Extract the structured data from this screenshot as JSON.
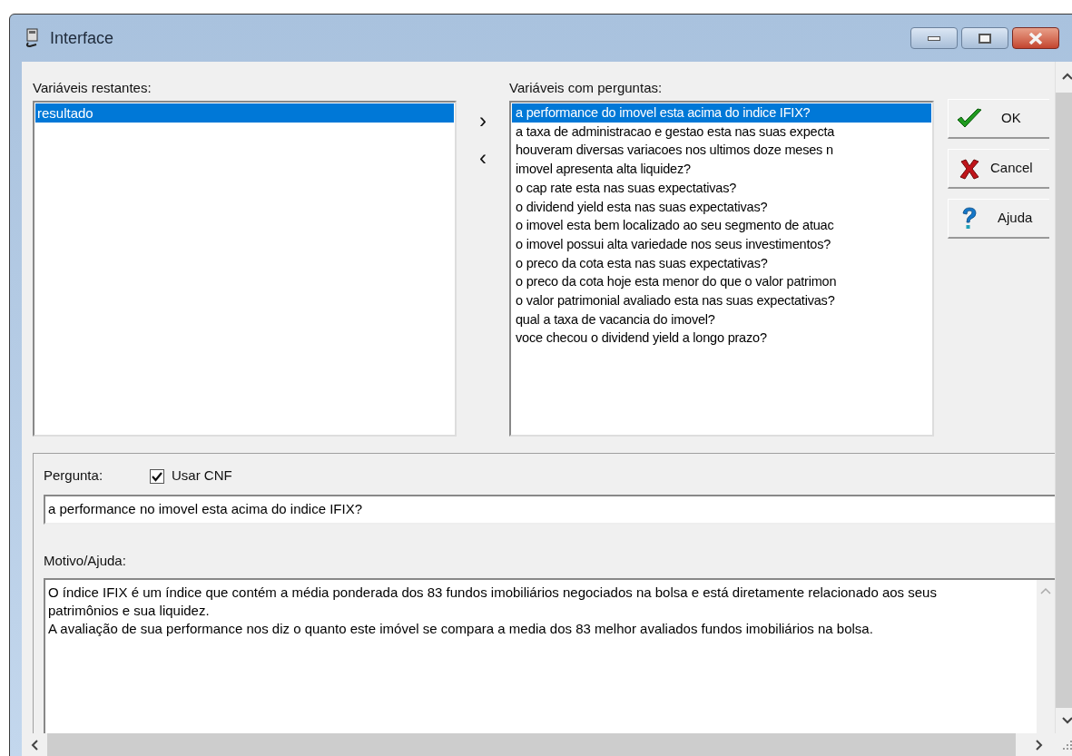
{
  "window": {
    "title": "Interface"
  },
  "remaining": {
    "label": "Variáveis restantes:",
    "items": [
      {
        "text": "resultado",
        "selected": true
      }
    ]
  },
  "move_buttons": [
    "›",
    "‹"
  ],
  "questions": {
    "label": "Variáveis com perguntas:",
    "items": [
      {
        "text": "a performance do imovel esta acima do indice IFIX?",
        "selected": true
      },
      {
        "text": "a taxa de administracao e gestao esta nas suas expecta",
        "selected": false
      },
      {
        "text": "houveram diversas variacoes nos ultimos doze meses n",
        "selected": false
      },
      {
        "text": "imovel apresenta alta liquidez?",
        "selected": false
      },
      {
        "text": "o cap rate esta nas suas expectativas?",
        "selected": false
      },
      {
        "text": "o dividend yield esta nas suas expectativas?",
        "selected": false
      },
      {
        "text": "o imovel esta bem localizado ao seu segmento de atuac",
        "selected": false
      },
      {
        "text": "o imovel possui alta variedade nos seus investimentos?",
        "selected": false
      },
      {
        "text": "o preco da cota esta nas suas expectativas?",
        "selected": false
      },
      {
        "text": "o preco da cota hoje esta menor do que o valor patrimon",
        "selected": false
      },
      {
        "text": "o valor patrimonial avaliado esta nas suas expectativas?",
        "selected": false
      },
      {
        "text": "qual a taxa de vacancia do imovel?",
        "selected": false
      },
      {
        "text": "voce checou o dividend yield a longo prazo?",
        "selected": false
      }
    ]
  },
  "buttons": [
    {
      "label": "OK",
      "kind": "ok"
    },
    {
      "label": "Cancel",
      "kind": "cancel"
    },
    {
      "label": "Ajuda",
      "kind": "help"
    }
  ],
  "question": {
    "label": "Pergunta:",
    "use_cnf": {
      "label": "Usar CNF",
      "checked": true
    },
    "value": "a performance no imovel esta acima do indice IFIX?"
  },
  "reason": {
    "label": "Motivo/Ajuda:",
    "paragraphs": [
      "O índice IFIX é um índice que contém a média ponderada dos 83 fundos imobiliários negociados na bolsa e está diretamente relacionado aos seus patrimônios e sua liquidez.",
      "A avaliação de sua performance nos diz o quanto este imóvel se compara a media dos 83 melhor avaliados fundos imobiliários na bolsa."
    ]
  }
}
